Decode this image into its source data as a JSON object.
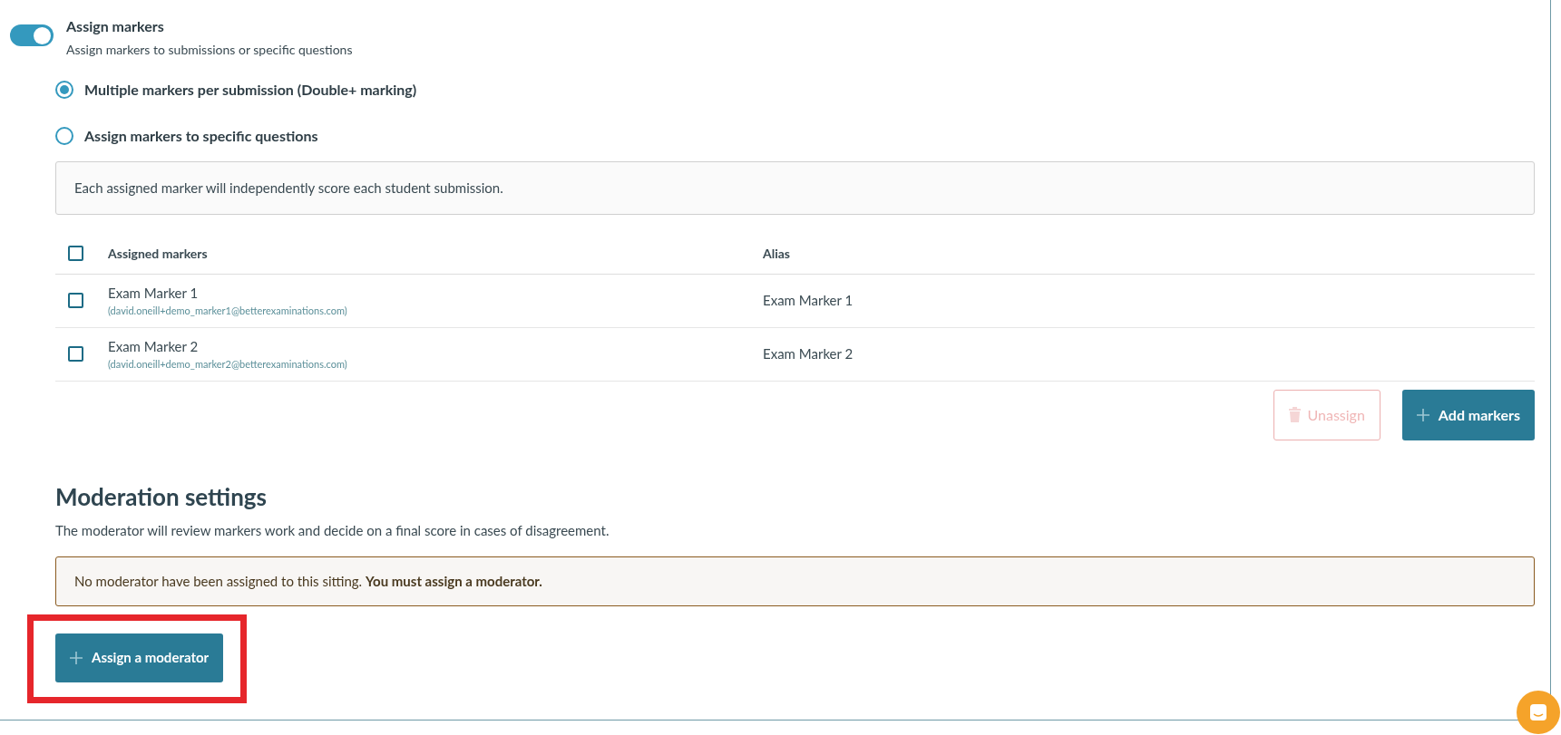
{
  "assign_markers": {
    "title": "Assign markers",
    "description": "Assign markers to submissions or specific questions",
    "on": true
  },
  "modes": [
    {
      "label": "Multiple markers per submission (Double+ marking)",
      "selected": true
    },
    {
      "label": "Assign markers to specific questions",
      "selected": false
    }
  ],
  "info": "Each assigned marker will independently score each student submission.",
  "table": {
    "select_all_checked": false,
    "columns": [
      "Assigned markers",
      "Alias"
    ],
    "rows": [
      {
        "name": "Exam Marker 1",
        "email": "(david.oneill+demo_marker1@betterexaminations.com)",
        "alias": "Exam Marker 1",
        "checked": false
      },
      {
        "name": "Exam Marker 2",
        "email": "(david.oneill+demo_marker2@betterexaminations.com)",
        "alias": "Exam Marker 2",
        "checked": false
      }
    ]
  },
  "actions": [
    {
      "label": "Unassign",
      "kind": "delete",
      "disabled": true
    },
    {
      "label": "Add markers",
      "kind": "add",
      "disabled": false
    }
  ],
  "moderation": {
    "title": "Moderation settings",
    "description": "The moderator will review markers work and decide on a final score in cases of disagreement.",
    "warning": "No moderator have been assigned to this sitting. **You must assign a moderator.**",
    "button": "Assign a moderator",
    "highlighted": true
  }
}
